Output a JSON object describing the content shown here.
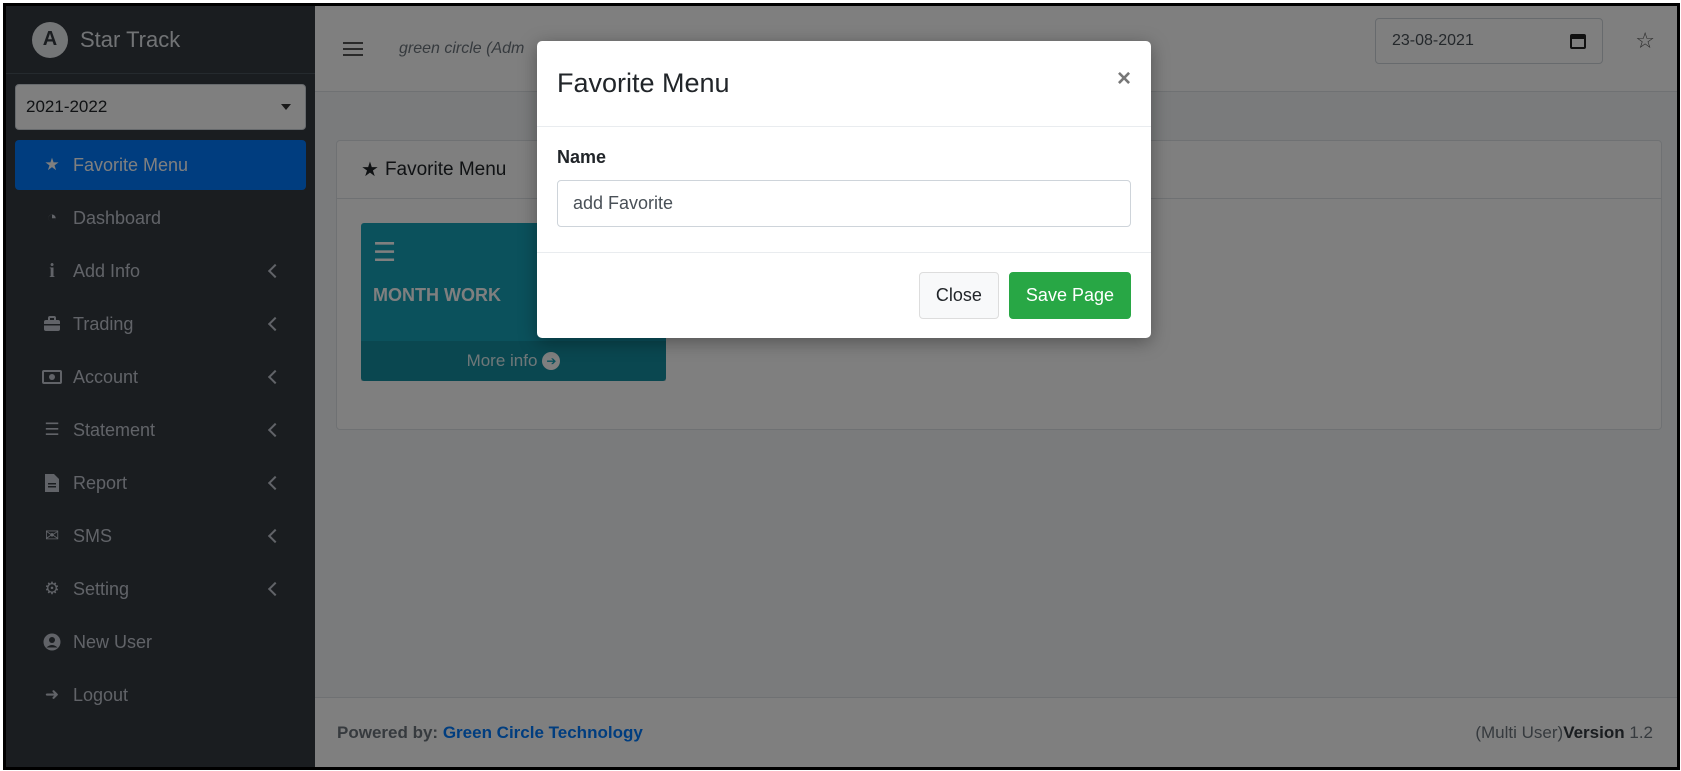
{
  "brand": {
    "name": "Star Track",
    "logo_letter": "A"
  },
  "year_select": {
    "value": "2021-2022"
  },
  "sidebar": {
    "items": [
      {
        "label": "Favorite Menu",
        "icon": "star-icon"
      },
      {
        "label": "Dashboard",
        "icon": "tachometer-icon"
      },
      {
        "label": "Add Info",
        "icon": "info-icon"
      },
      {
        "label": "Trading",
        "icon": "briefcase-icon"
      },
      {
        "label": "Account",
        "icon": "money-bill-icon"
      },
      {
        "label": "Statement",
        "icon": "tasks-icon"
      },
      {
        "label": "Report",
        "icon": "file-icon"
      },
      {
        "label": "SMS",
        "icon": "envelope-icon"
      },
      {
        "label": "Setting",
        "icon": "cogs-icon"
      },
      {
        "label": "New User",
        "icon": "user-circle-icon"
      },
      {
        "label": "Logout",
        "icon": "sign-out-icon"
      }
    ]
  },
  "topbar": {
    "org_text": "green circle (Adm",
    "date": "23-08-2021"
  },
  "content": {
    "card_title": "Favorite Menu",
    "tile": {
      "title": "MONTH WORK",
      "footer": "More info"
    }
  },
  "footer": {
    "powered_label": "Powered by:",
    "company": "Green Circle Technology",
    "mode": "(Multi User)",
    "version_word": "Version",
    "version_number": "1.2"
  },
  "modal": {
    "title": "Favorite Menu",
    "close_symbol": "×",
    "field_label": "Name",
    "field_value": "add Favorite",
    "close_button": "Close",
    "save_button": "Save Page"
  },
  "colors": {
    "sidebar_bg": "#343a40",
    "active_blue": "#007bff",
    "tile_teal": "#17a2b8",
    "save_green": "#28a745"
  }
}
